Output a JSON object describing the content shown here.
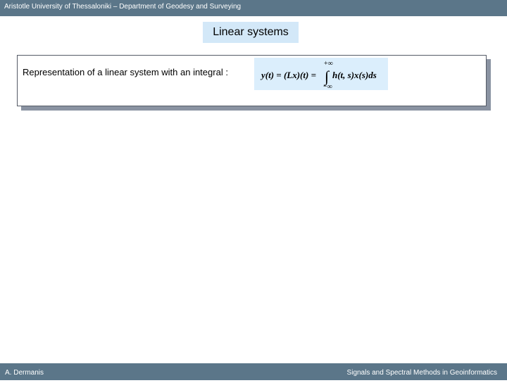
{
  "header": {
    "text": "Aristotle University of Thessaloniki – Department of Geodesy and Surveying"
  },
  "slide": {
    "title": "Linear systems",
    "description": "Representation of a linear system with an integral :",
    "formula": {
      "lhs": "y(t) = (Lx)(t) =",
      "upper_limit": "+∞",
      "lower_limit": "−∞",
      "integral_sign": "∫",
      "integrand": "h(t, s)x(s)ds"
    }
  },
  "footer": {
    "author": "A. Dermanis",
    "course": "Signals and Spectral Methods in Geoinformatics"
  }
}
